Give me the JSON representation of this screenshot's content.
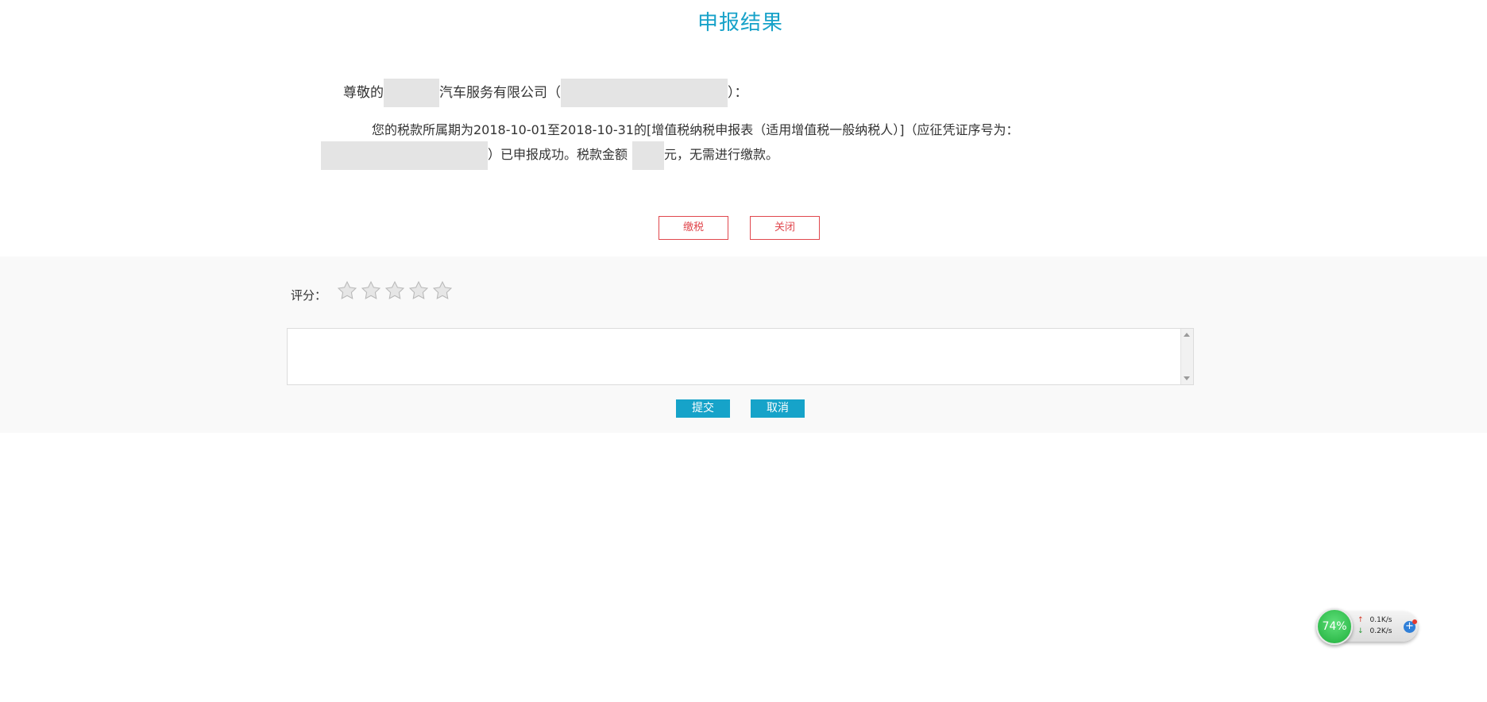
{
  "page": {
    "title": "申报结果"
  },
  "greeting": {
    "prefix": "尊敬的",
    "company_suffix": "汽车服务有限公司（",
    "closing": "）："
  },
  "message": {
    "line1": "您的税款所属期为2018-10-01至2018-10-31的[增值税纳税申报表（适用增值税一般纳税人）]（应征凭证序号为：",
    "line2_part1": "）已申报成功。税款金额",
    "line2_part2": "元，无需进行缴款。"
  },
  "actions": {
    "pay_label": "缴税",
    "close_label": "关闭"
  },
  "rating": {
    "label": "评分：",
    "max_stars": 5,
    "value": 0,
    "submit_label": "提交",
    "cancel_label": "取消",
    "textarea_value": ""
  },
  "widget": {
    "percent": "74%",
    "upload": "0.1K/s",
    "download": "0.2K/s",
    "up_icon": "arrow-up-icon",
    "down_icon": "arrow-down-icon",
    "plus_icon": "plus-icon"
  },
  "colors": {
    "accent": "#17a2c9",
    "outline_button": "#e0474d",
    "solid_button": "#16a3c9",
    "mask": "#e4e4e4"
  }
}
